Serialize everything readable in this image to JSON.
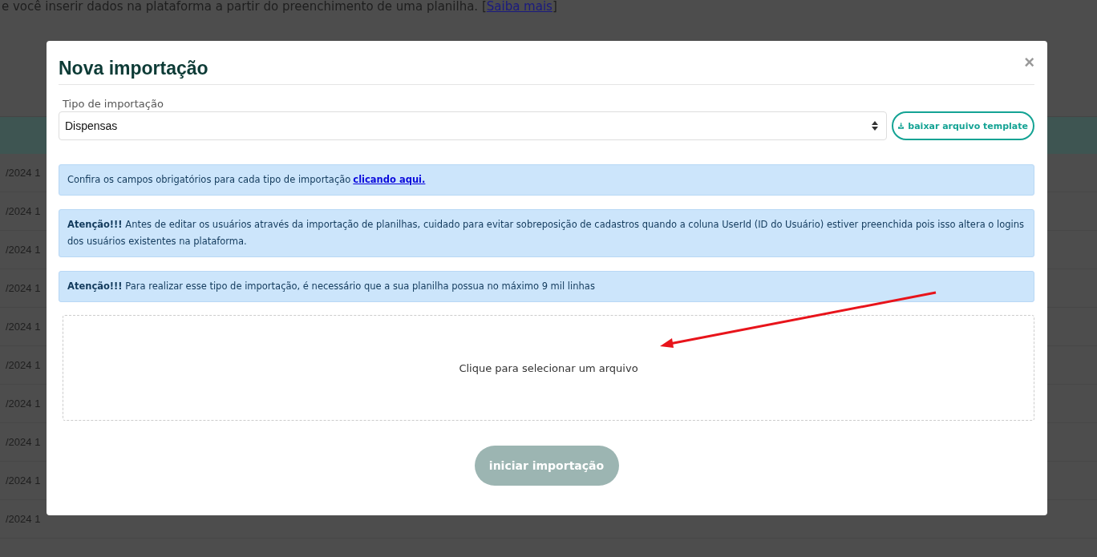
{
  "background": {
    "intro": {
      "before": "e você inserir dados na plataforma a partir do preenchimento de uma planilha. [",
      "link": "Saiba mais",
      "after": "]"
    },
    "table_rows": [
      {
        "column_1": "/2024 1"
      },
      {
        "column_1": "/2024 1"
      },
      {
        "column_1": "/2024 1"
      },
      {
        "column_1": "/2024 1"
      },
      {
        "column_1": "/2024 1"
      },
      {
        "column_1": "/2024 1"
      },
      {
        "column_1": "/2024 1"
      },
      {
        "column_1": "/2024 1"
      },
      {
        "column_1": "/2024 1"
      },
      {
        "column_1": "/2024 1"
      }
    ]
  },
  "modal": {
    "title": "Nova importação",
    "close": "×",
    "import_type": {
      "label": "Tipo de importação",
      "value": "Dispensas"
    },
    "template_button": "baixar arquivo template",
    "notices": [
      {
        "kind": "link",
        "text": "Confira os campos obrigatórios para cada tipo de importação",
        "link": "clicando aqui."
      },
      {
        "kind": "plain",
        "text": "**Atenção!!!** Antes de editar os usuários através da importação de planilhas, cuidado para evitar sobreposição de cadastros quando a coluna UserId (ID do Usuário) estiver preenchida pois isso altera o logins dos usuários existentes na plataforma."
      },
      {
        "kind": "plain",
        "text": "**Atenção!!!** Para realizar esse tipo de importação, é necessário que a sua planilha possua no máximo 9 mil linhas"
      }
    ],
    "dropzone": "Clique para selecionar um arquivo",
    "submit": {
      "label": "iniciar importação",
      "disabled": true
    }
  }
}
